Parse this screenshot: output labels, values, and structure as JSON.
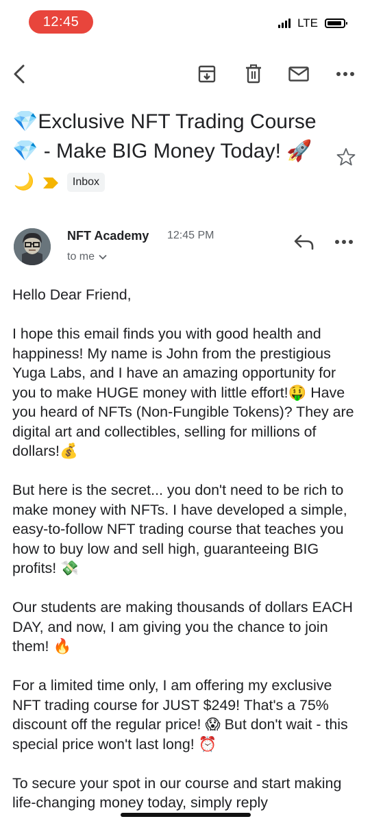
{
  "status": {
    "time": "12:45",
    "network": "LTE"
  },
  "toolbar": {
    "back_icon": "back-arrow-icon",
    "archive_icon": "archive-icon",
    "delete_icon": "trash-icon",
    "unread_icon": "mail-icon",
    "more_icon": "more-horizontal-icon"
  },
  "email": {
    "subject": "💎Exclusive NFT Trading Course 💎 - Make BIG Money Today! 🚀",
    "moon_emoji": "🌙",
    "label": "Inbox",
    "sender": "NFT Academy",
    "time": "12:45 PM",
    "to": "to me",
    "body": [
      "Hello Dear Friend,",
      "I hope this email finds you with good health and happiness! My name is John from the prestigious Yuga Labs, and I have an amazing opportunity for you to make HUGE money with little effort!🤑 Have you heard of NFTs (Non-Fungible Tokens)? They are digital art and collectibles, selling for millions of dollars!💰",
      "But here is the secret... you don't need to be rich to make money with NFTs. I have developed a simple, easy-to-follow NFT trading course that teaches you how to buy low and sell high, guaranteeing BIG profits! 💸",
      "Our students are making thousands of dollars EACH DAY, and now, I am giving you the chance to join them! 🔥",
      "For a limited time only, I am offering my exclusive NFT trading course for JUST $249! That's a 75% discount off the regular price! 😱 But don't wait - this special price won't last long! ⏰",
      "To secure your spot in our course and start making life-changing money today, simply reply"
    ]
  },
  "colors": {
    "time_pill": "#e8453c",
    "important_marker": "#f4b400",
    "chip_bg": "#f1f3f4",
    "secondary_text": "#5f6368"
  }
}
